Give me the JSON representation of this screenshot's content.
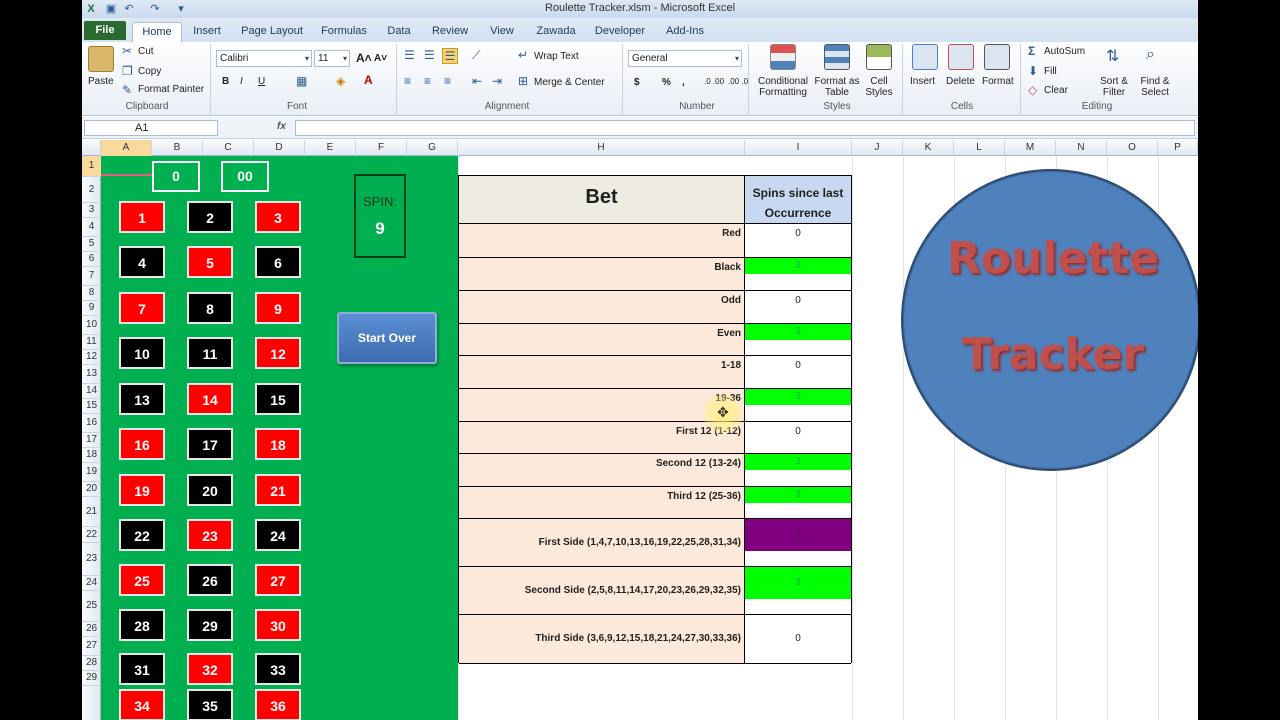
{
  "window": {
    "title": "Roulette Tracker.xlsm  -  Microsoft Excel"
  },
  "tabs": [
    "File",
    "Home",
    "Insert",
    "Page Layout",
    "Formulas",
    "Data",
    "Review",
    "View",
    "Zawada",
    "Developer",
    "Add-Ins"
  ],
  "ribbon": {
    "clipboard": {
      "paste": "Paste",
      "cut": "Cut",
      "copy": "Copy",
      "format_painter": "Format Painter",
      "label": "Clipboard"
    },
    "font": {
      "name": "Calibri",
      "size": "11",
      "bold": "B",
      "italic": "I",
      "underline": "U",
      "label": "Font"
    },
    "alignment": {
      "wrap": "Wrap Text",
      "merge": "Merge & Center",
      "label": "Alignment"
    },
    "number": {
      "format": "General",
      "currency": "$",
      "percent": "%",
      "comma": ",",
      "inc_dec": ".0 .00",
      "dec_dec": ".00 .0",
      "label": "Number"
    },
    "styles": {
      "conditional": "Conditional Formatting",
      "as_table": "Format as Table",
      "cell_styles": "Cell Styles",
      "label": "Styles"
    },
    "cells": {
      "insert": "Insert",
      "delete": "Delete",
      "format": "Format",
      "label": "Cells"
    },
    "editing": {
      "autosum": "AutoSum",
      "fill": "Fill",
      "clear": "Clear",
      "sort": "Sort & Filter",
      "find": "Find & Select",
      "label": "Editing"
    }
  },
  "formula_bar": {
    "name_box": "A1",
    "fx": "fx",
    "value": ""
  },
  "columns": [
    "A",
    "B",
    "C",
    "D",
    "E",
    "F",
    "G",
    "H",
    "I",
    "J",
    "K",
    "L",
    "M",
    "N",
    "O",
    "P"
  ],
  "rows": [
    "1",
    "2",
    "3",
    "4",
    "5",
    "6",
    "7",
    "8",
    "9",
    "10",
    "11",
    "12",
    "13",
    "14",
    "15",
    "16",
    "17",
    "18",
    "19",
    "20",
    "21",
    "22",
    "23",
    "24",
    "25",
    "26",
    "27",
    "28",
    "29"
  ],
  "roulette": {
    "zero": "0",
    "double_zero": "00",
    "numbers": [
      [
        "1",
        "red"
      ],
      [
        "2",
        "black"
      ],
      [
        "3",
        "red"
      ],
      [
        "4",
        "black"
      ],
      [
        "5",
        "red"
      ],
      [
        "6",
        "black"
      ],
      [
        "7",
        "red"
      ],
      [
        "8",
        "black"
      ],
      [
        "9",
        "red"
      ],
      [
        "10",
        "black"
      ],
      [
        "11",
        "black"
      ],
      [
        "12",
        "red"
      ],
      [
        "13",
        "black"
      ],
      [
        "14",
        "red"
      ],
      [
        "15",
        "black"
      ],
      [
        "16",
        "red"
      ],
      [
        "17",
        "black"
      ],
      [
        "18",
        "red"
      ],
      [
        "19",
        "red"
      ],
      [
        "20",
        "black"
      ],
      [
        "21",
        "red"
      ],
      [
        "22",
        "black"
      ],
      [
        "23",
        "red"
      ],
      [
        "24",
        "black"
      ],
      [
        "25",
        "red"
      ],
      [
        "26",
        "black"
      ],
      [
        "27",
        "red"
      ],
      [
        "28",
        "black"
      ],
      [
        "29",
        "black"
      ],
      [
        "30",
        "red"
      ],
      [
        "31",
        "black"
      ],
      [
        "32",
        "red"
      ],
      [
        "33",
        "black"
      ],
      [
        "34",
        "red"
      ],
      [
        "35",
        "black"
      ],
      [
        "36",
        "red"
      ]
    ]
  },
  "spin": {
    "label": "SPIN:",
    "value": "9"
  },
  "start_over": "Start Over",
  "bet_table": {
    "header_bet": "Bet",
    "header_spins": "Spins since last Occurrence",
    "rows": [
      {
        "label": "Red",
        "value": "0",
        "highlight": "none"
      },
      {
        "label": "Black",
        "value": "3",
        "highlight": "#00ff00"
      },
      {
        "label": "Odd",
        "value": "0",
        "highlight": "none"
      },
      {
        "label": "Even",
        "value": "3",
        "highlight": "#00ff00"
      },
      {
        "label": "1-18",
        "value": "0",
        "highlight": "none"
      },
      {
        "label": "19-36",
        "value": "3",
        "highlight": "#00ff00"
      },
      {
        "label": "First 12 (1-12)",
        "value": "0",
        "highlight": "none"
      },
      {
        "label": "Second 12 (13-24)",
        "value": "3",
        "highlight": "#00ff00"
      },
      {
        "label": "Third 12 (25-36)",
        "value": "3",
        "highlight": "#00ff00"
      },
      {
        "label": "First Side (1,4,7,10,13,16,19,22,25,28,31,34)",
        "value": "3",
        "highlight": "#800080"
      },
      {
        "label": "Second Side (2,5,8,11,14,17,20,23,26,29,32,35)",
        "value": "3",
        "highlight": "#00ff00"
      },
      {
        "label": "Third Side (3,6,9,12,15,18,21,24,27,30,33,36)",
        "value": "0",
        "highlight": "none"
      }
    ]
  },
  "logo": {
    "line1": "Roulette",
    "line2": "Tracker"
  },
  "colors": {
    "felt": "#00b050",
    "red": "#ff0000",
    "black": "#000000",
    "hit_green": "#00ff00",
    "hit_purple": "#800080"
  }
}
